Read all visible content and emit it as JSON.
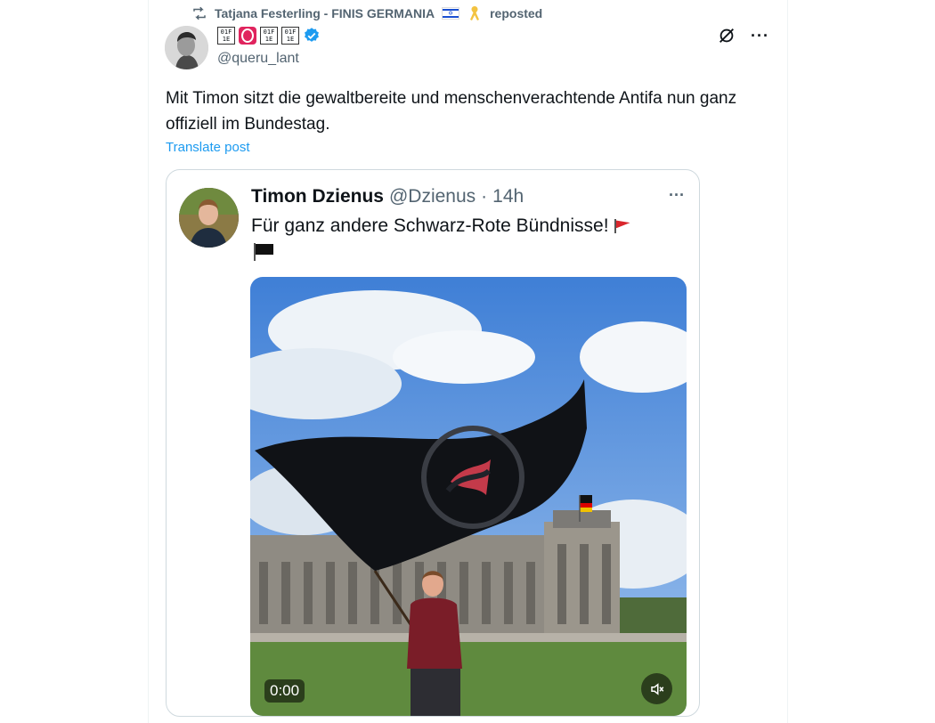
{
  "repost": {
    "user": "Tatjana Festerling - FINIS GERMANIA",
    "label": "reposted",
    "icon": "repost-icon"
  },
  "post": {
    "display_name_icons": [
      "box-glyph-icon",
      "red-o-icon",
      "box-glyph-icon",
      "box-glyph-icon"
    ],
    "verified": true,
    "handle": "@queru_lant",
    "text": "Mit Timon sitzt die gewaltbereite und menschenverachtende Antifa nun ganz offiziell im Bundestag.",
    "translate_label": "Translate post",
    "grok_icon": "grok-icon",
    "more_icon": "more-icon"
  },
  "quote": {
    "name": "Timon Dzienus",
    "handle": "@Dzienus",
    "separator": "·",
    "time": "14h",
    "text": "Für ganz andere Schwarz-Rote Bündnisse!",
    "video": {
      "timecode": "0:00",
      "mute_icon": "mute-icon"
    }
  },
  "colors": {
    "accent": "#1d9bf0",
    "secondary_text": "#536471",
    "border": "#cfd9de",
    "verified": "#1d9bf0"
  }
}
